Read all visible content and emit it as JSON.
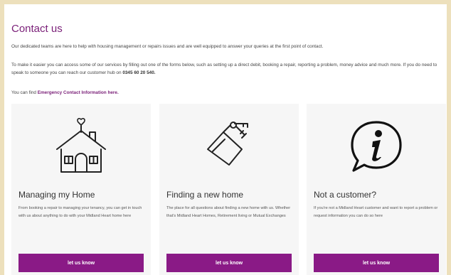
{
  "colors": {
    "brand": "#7a1f78",
    "button": "#8a1a86",
    "border": "#ede0bc"
  },
  "header": {
    "title": "Contact us"
  },
  "intro": {
    "p1": "Our dedicated teams are here to help with housing management or repairs issues and are well equipped to answer your queries at the first point of contact.",
    "p2": "To make it easier you can access some of our services by filling out one of the forms below, such as setting up a direct debit, booking a repair, reporting a problem, money advice and much more. If you do need to speak to someone you can reach our customer hub on",
    "phone": "0345 60 20 540.",
    "p3_prefix": "You can find",
    "emergency_link": "Emergency Contact Information here."
  },
  "cards": [
    {
      "icon": "house-heart-icon",
      "title": "Managing my Home",
      "description": "From booking a repair to managing your tenancy, you can get in touch with us about anything to do with your Midland Heart home here",
      "button": "let us know"
    },
    {
      "icon": "house-keys-icon",
      "title": "Finding a new home",
      "description": "The place for all questions about finding a new home with us. Whether that's Midland Heart Homes, Retirement living or Mutual Exchanges",
      "button": "let us know"
    },
    {
      "icon": "information-icon",
      "title": "Not a customer?",
      "description": "If you're not a Midland Heart customer and want to report a problem or request information you can do so here",
      "button": "let us know"
    }
  ]
}
